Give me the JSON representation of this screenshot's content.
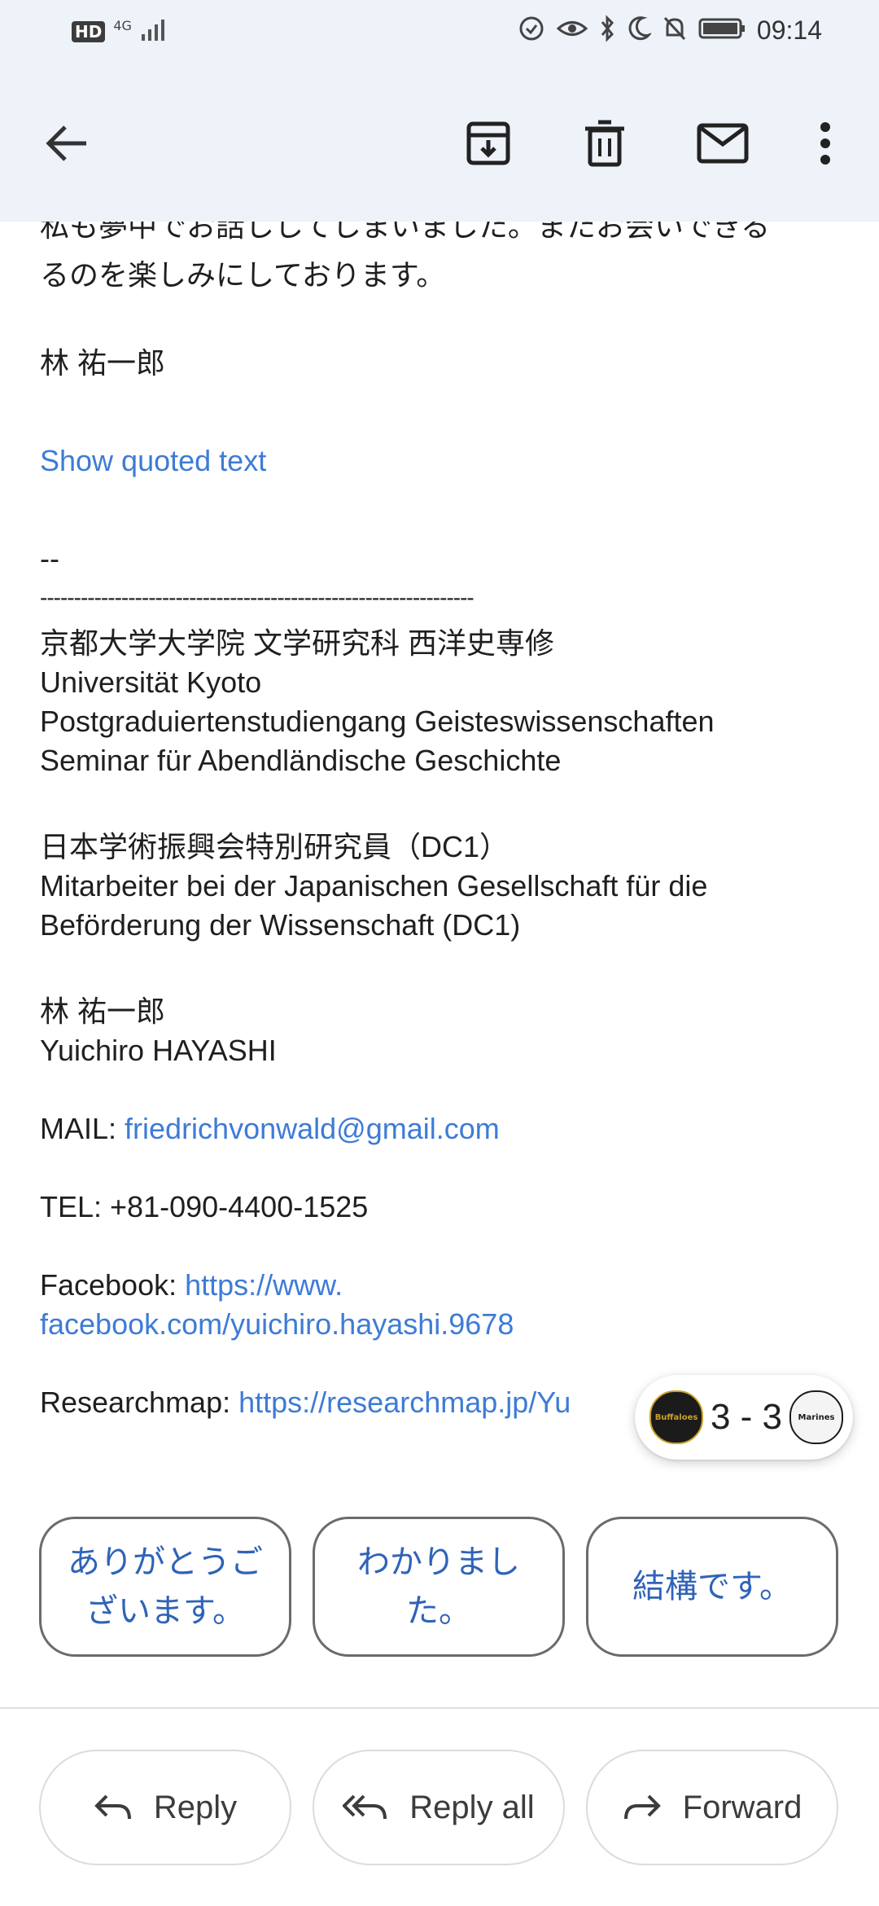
{
  "status_bar": {
    "network_badge": "HD",
    "network_type": "4G",
    "time": "09:14"
  },
  "toolbar": {
    "back_icon": "arrow-left-icon",
    "archive_icon": "archive-icon",
    "delete_icon": "trash-icon",
    "mark_unread_icon": "mail-icon",
    "more_icon": "more-vert-icon"
  },
  "email": {
    "body_line_1": "私も夢中でお話ししてしまいました。またお会いできる",
    "body_line_2": "るのを楽しみにしております。",
    "sign_name": "林 祐一郎",
    "show_quoted": "Show quoted text",
    "sig_dash": "--",
    "sig_rule": "----------------------------------------------------------------",
    "sig_line_1": "京都大学大学院 文学研究科 西洋史専修",
    "sig_line_2": "Universität Kyoto",
    "sig_line_3": "Postgraduiertenstudiengang Geisteswissenschaften",
    "sig_line_4": "Seminar für Abendländische Geschichte",
    "sig_line_5": "日本学術振興会特別研究員（DC1）",
    "sig_line_6": "Mitarbeiter bei der Japanischen Gesellschaft für die",
    "sig_line_7": "Beförderung der Wissenschaft (DC1)",
    "sig_name_jp": "林 祐一郎",
    "sig_name_en": "Yuichiro HAYASHI",
    "mail_label": "MAIL: ",
    "mail_value": "friedrichvonwald@gmail.com",
    "tel": "TEL: +81-090-4400-1525",
    "facebook_label": "Facebook: ",
    "facebook_url_1": "https://www.",
    "facebook_url_2": "facebook.com/yuichiro.hayashi.9678",
    "researchmap_label": "Researchmap: ",
    "researchmap_url": "https://researchmap.jp/Yu"
  },
  "score_widget": {
    "score": "3 - 3",
    "home_logo_text": "Buffaloes",
    "away_logo_text": "Marines"
  },
  "smart_replies": [
    "ありがとうございます。",
    "わかりました。",
    "結構です。"
  ],
  "actions": {
    "reply": "Reply",
    "reply_all": "Reply all",
    "forward": "Forward"
  },
  "colors": {
    "link": "#3e7bd6",
    "header_bg": "#eef2f9",
    "smart_reply_text": "#2f63b8"
  }
}
